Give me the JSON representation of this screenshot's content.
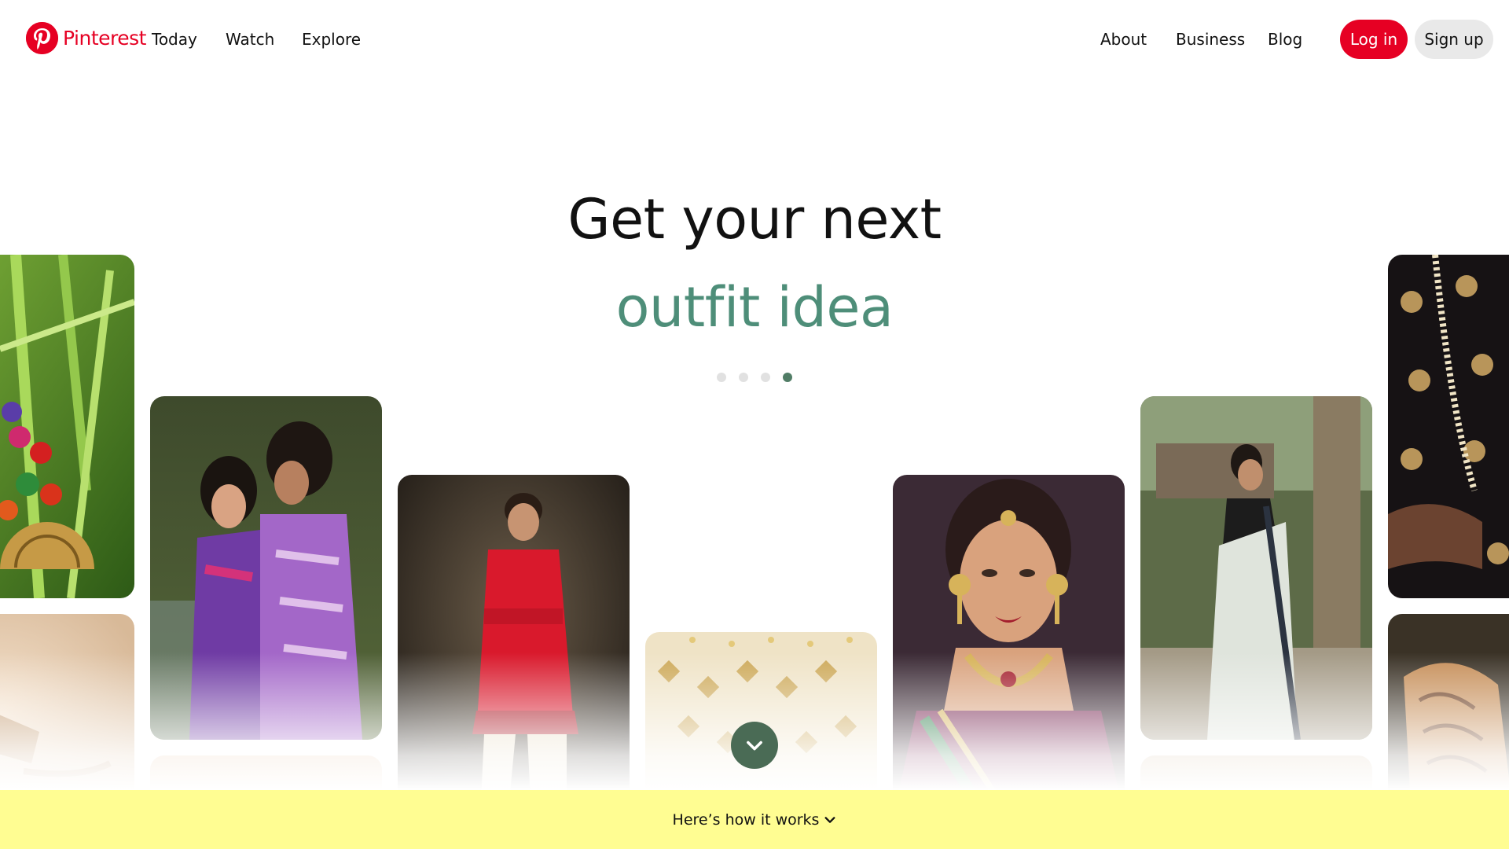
{
  "header": {
    "brand": "Pinterest",
    "nav_left": [
      "Today",
      "Watch",
      "Explore"
    ],
    "nav_right": [
      "About",
      "Business",
      "Blog"
    ],
    "login_label": "Log in",
    "signup_label": "Sign up"
  },
  "hero": {
    "line1": "Get your next",
    "line2": "outfit idea",
    "slides_total": 4,
    "active_slide": 4
  },
  "pins": [
    "jewelry-on-leaves",
    "couple-in-purple-outfits",
    "man-in-red-sherwani",
    "mirror-work-fabric",
    "woman-with-bridal-jewelry",
    "woman-in-white-saree",
    "black-embroidered-kurta",
    "beige-fabric-detail",
    "mehndi-hand-detail"
  ],
  "banner": {
    "label": "Here’s how it works"
  },
  "colors": {
    "brand_red": "#e60023",
    "hero_accent": "#4e8e79",
    "dot_active": "#517d66",
    "scroll_button": "#4a6b55",
    "banner_bg": "#fffd92"
  },
  "icons": {
    "logo": "pinterest-logo-icon",
    "scroll": "chevron-down-icon",
    "banner": "chevron-down-icon"
  }
}
